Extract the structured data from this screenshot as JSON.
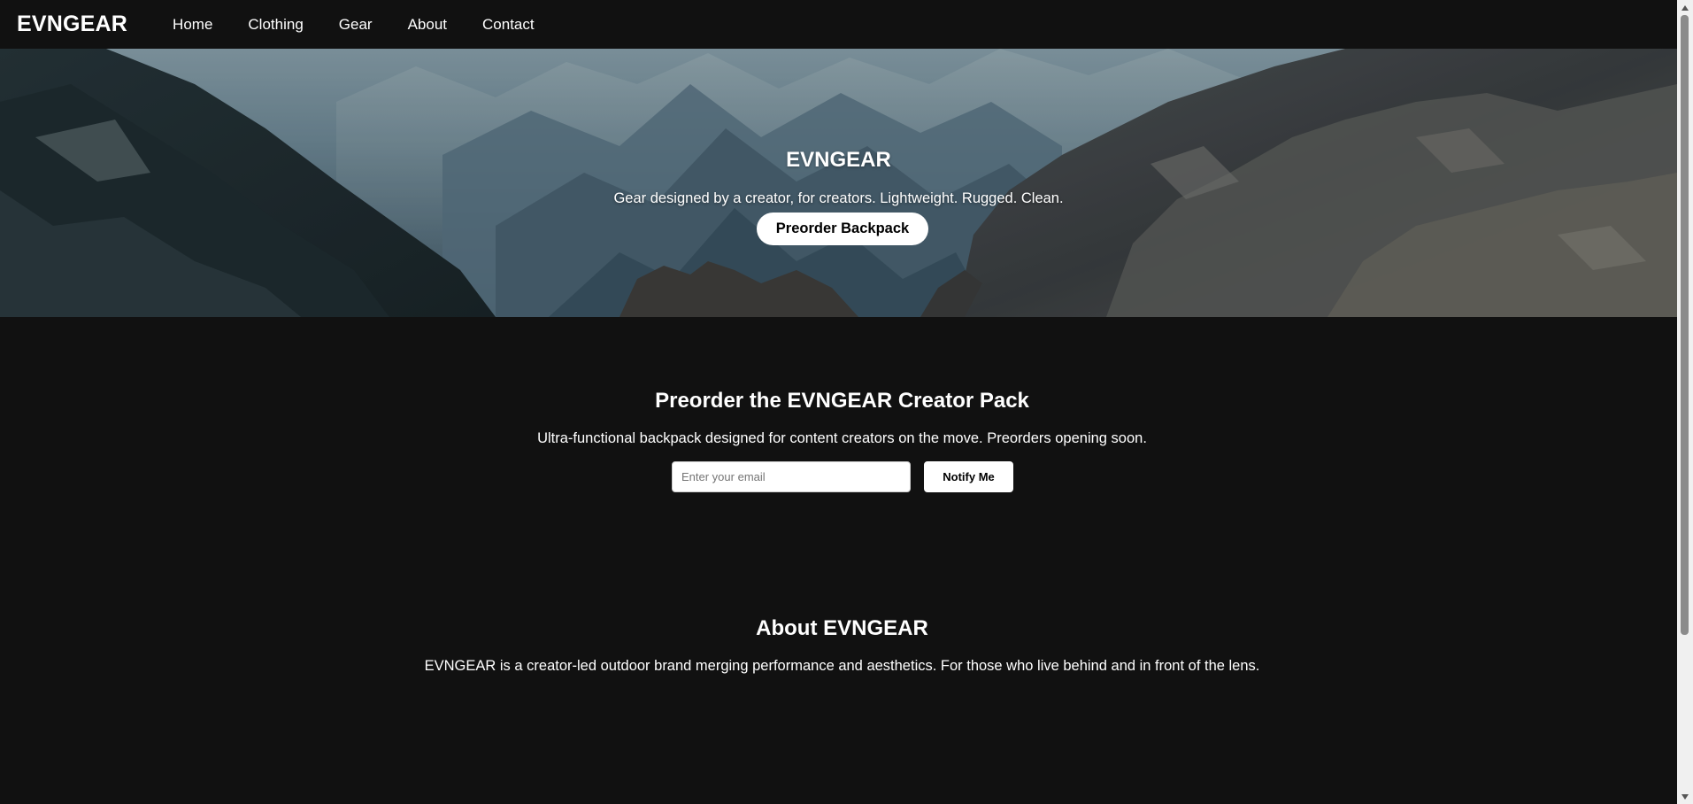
{
  "nav": {
    "brand": "EVNGEAR",
    "links": [
      "Home",
      "Clothing",
      "Gear",
      "About",
      "Contact"
    ]
  },
  "hero": {
    "title": "EVNGEAR",
    "subtitle": "Gear designed by a creator, for creators. Lightweight. Rugged. Clean.",
    "cta_label": "Preorder Backpack",
    "background": "mountain-valley-photo"
  },
  "preorder": {
    "title": "Preorder the EVNGEAR Creator Pack",
    "text": "Ultra-functional backpack designed for content creators on the move. Preorders opening soon.",
    "email_placeholder": "Enter your email",
    "email_value": "",
    "button_label": "Notify Me"
  },
  "about": {
    "title": "About EVNGEAR",
    "text": "EVNGEAR is a creator-led outdoor brand merging performance and aesthetics. For those who live behind and in front of the lens."
  },
  "colors": {
    "page_bg": "#111111",
    "text": "#ffffff",
    "button_bg": "#ffffff",
    "button_text": "#000000"
  }
}
